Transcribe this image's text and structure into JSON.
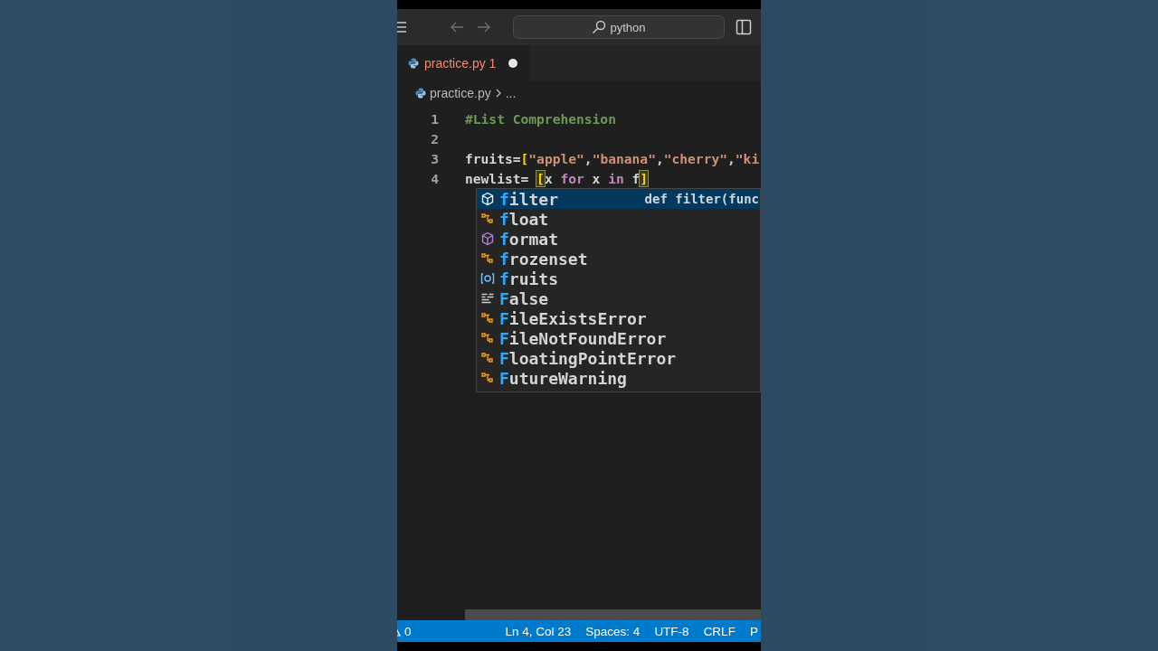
{
  "title_bar": {
    "search": {
      "value": "python"
    }
  },
  "tabs": [
    {
      "label": "practice.py 1",
      "selected": true,
      "errors": true,
      "dirty": true
    }
  ],
  "breadcrumb": [
    "practice.py",
    "..."
  ],
  "code_lines": [
    {
      "number": "1",
      "tokens": [
        {
          "kind": "comment",
          "text": "#List Comprehension"
        }
      ]
    },
    {
      "number": "2"
    },
    {
      "number": "3",
      "tokens": [
        {
          "kind": "plain",
          "text": "fruits="
        },
        {
          "kind": "bracket",
          "text": "["
        },
        {
          "kind": "string",
          "text": "\"apple\""
        },
        {
          "kind": "plain",
          "text": ","
        },
        {
          "kind": "string",
          "text": "\"banana\""
        },
        {
          "kind": "plain",
          "text": ","
        },
        {
          "kind": "string",
          "text": "\"cherry\""
        },
        {
          "kind": "plain",
          "text": ","
        },
        {
          "kind": "string",
          "text": "\"ki"
        }
      ]
    },
    {
      "number": "4",
      "tokens": [
        {
          "kind": "plain",
          "text": "newlist= "
        },
        {
          "kind": "bracket",
          "text": "[",
          "matched": true
        },
        {
          "kind": "plain",
          "text": "x "
        },
        {
          "kind": "keyword",
          "text": "for"
        },
        {
          "kind": "plain",
          "text": " x "
        },
        {
          "kind": "keyword",
          "text": "in"
        },
        {
          "kind": "plain",
          "text": " f"
        },
        {
          "kind": "bracket",
          "text": "]",
          "matched": true
        }
      ]
    }
  ],
  "suggestions": [
    {
      "kind": "function",
      "match": "f",
      "rest": "ilter",
      "detail": "def filter(func",
      "selected": true
    },
    {
      "kind": "class",
      "match": "f",
      "rest": "loat",
      "selected": false
    },
    {
      "kind": "function",
      "match": "f",
      "rest": "ormat",
      "selected": false
    },
    {
      "kind": "class",
      "match": "f",
      "rest": "rozenset",
      "selected": false
    },
    {
      "kind": "variable",
      "match": "f",
      "rest": "ruits",
      "selected": false
    },
    {
      "kind": "keyword",
      "match": "F",
      "rest": "alse",
      "selected": false
    },
    {
      "kind": "class",
      "match": "F",
      "rest": "ileExistsError",
      "selected": false
    },
    {
      "kind": "class",
      "match": "F",
      "rest": "ileNotFoundError",
      "selected": false
    },
    {
      "kind": "class",
      "match": "F",
      "rest": "loatingPointError",
      "selected": false
    },
    {
      "kind": "class",
      "match": "F",
      "rest": "utureWarning",
      "selected": false
    }
  ],
  "status_bar": [
    {
      "kind": "warnings",
      "text": "0"
    },
    {
      "kind": "text",
      "text": "Ln 4, Col 23"
    },
    {
      "kind": "text",
      "text": "Spaces: 4"
    },
    {
      "kind": "text",
      "text": "UTF-8"
    },
    {
      "kind": "text",
      "text": "CRLF"
    },
    {
      "kind": "text",
      "text": "P"
    }
  ]
}
